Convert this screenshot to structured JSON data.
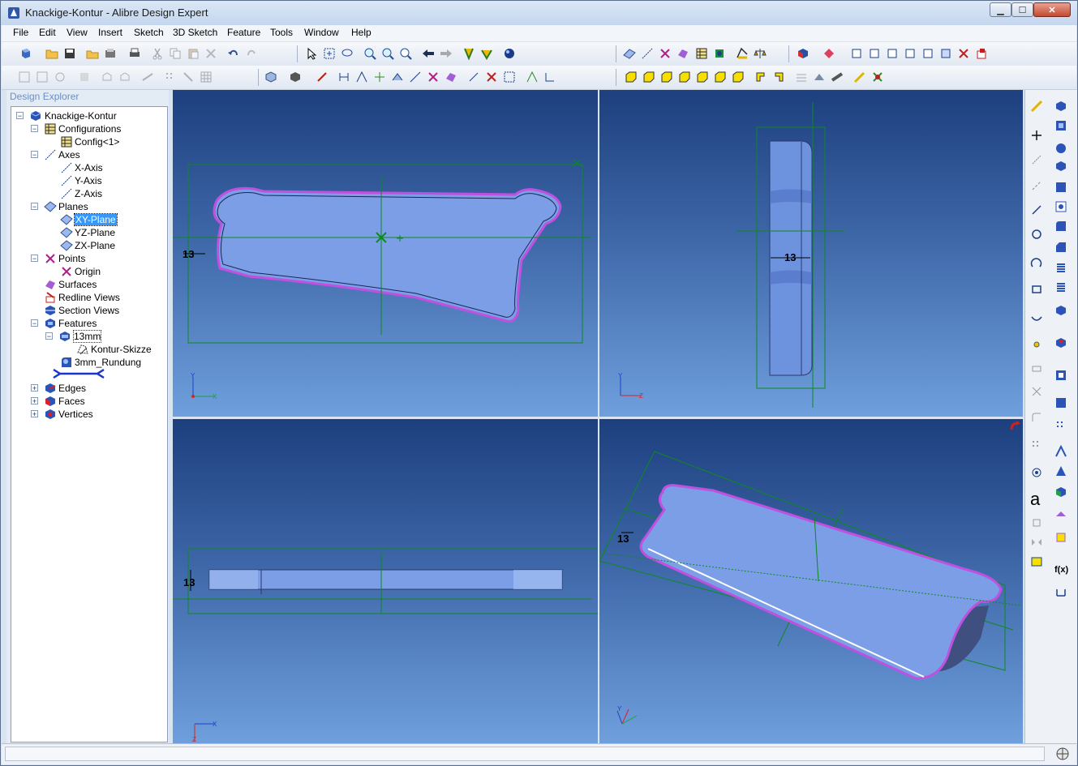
{
  "window": {
    "title": "Knackige-Kontur - Alibre Design Expert",
    "min_label": "▁",
    "max_label": "☐",
    "close_label": "✕"
  },
  "menu": [
    "File",
    "Edit",
    "View",
    "Insert",
    "Sketch",
    "3D Sketch",
    "Feature",
    "Tools",
    "Window",
    "Help"
  ],
  "explorer": {
    "title": "Design Explorer",
    "nodes": [
      {
        "label": "Knackige-Kontur",
        "icon": "part-icon"
      },
      {
        "label": "Configurations",
        "icon": "table-icon"
      },
      {
        "label": "Config<1>",
        "icon": "table-icon"
      },
      {
        "label": "Axes",
        "icon": "axis-icon"
      },
      {
        "label": "X-Axis",
        "icon": "axis-icon"
      },
      {
        "label": "Y-Axis",
        "icon": "axis-icon"
      },
      {
        "label": "Z-Axis",
        "icon": "axis-icon"
      },
      {
        "label": "Planes",
        "icon": "plane-icon"
      },
      {
        "label": "XY-Plane",
        "icon": "plane-icon"
      },
      {
        "label": "YZ-Plane",
        "icon": "plane-icon"
      },
      {
        "label": "ZX-Plane",
        "icon": "plane-icon"
      },
      {
        "label": "Points",
        "icon": "point-icon"
      },
      {
        "label": "Origin",
        "icon": "point-icon"
      },
      {
        "label": "Surfaces",
        "icon": "surface-icon"
      },
      {
        "label": "Redline Views",
        "icon": "redline-icon"
      },
      {
        "label": "Section Views",
        "icon": "section-icon"
      },
      {
        "label": "Features",
        "icon": "features-icon"
      },
      {
        "label": "13mm",
        "icon": "extrude-icon"
      },
      {
        "label": "Kontur-Skizze",
        "icon": "sketch-icon"
      },
      {
        "label": "3mm_Rundung",
        "icon": "fillet-icon"
      },
      {
        "label": "Edges",
        "icon": "edges-icon"
      },
      {
        "label": "Faces",
        "icon": "faces-icon"
      },
      {
        "label": "Vertices",
        "icon": "vertices-icon"
      }
    ]
  },
  "viewports": {
    "front_dim": "13",
    "side_dim": "13",
    "top_dim": "13",
    "iso_dim": "13",
    "axis_y": "Y",
    "axis_x": "X",
    "axis_z": "Z"
  },
  "side_palette": {
    "text_tool": "a",
    "function_tool": "f(x)"
  },
  "colors": {
    "viewport_top": "#1d3f7e",
    "viewport_bottom": "#6f9fdd",
    "part_fill": "#7b9ee6",
    "part_edge": "#c050e0",
    "sketch_line": "#0c8a1e",
    "selection": "#3399ff"
  }
}
